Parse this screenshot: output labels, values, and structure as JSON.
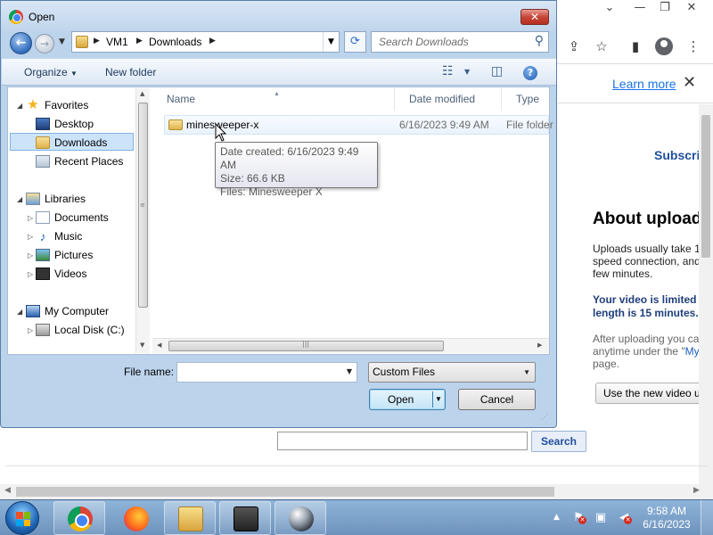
{
  "dialog": {
    "title": "Open",
    "close_label": "✕",
    "breadcrumb": [
      "VM1",
      "Downloads"
    ],
    "search_placeholder": "Search Downloads",
    "toolbar": {
      "organize": "Organize",
      "new_folder": "New folder"
    },
    "nav": {
      "favorites": "Favorites",
      "desktop": "Desktop",
      "downloads": "Downloads",
      "recent_places": "Recent Places",
      "libraries": "Libraries",
      "documents": "Documents",
      "music": "Music",
      "pictures": "Pictures",
      "videos": "Videos",
      "my_computer": "My Computer",
      "local_disk": "Local Disk (C:)"
    },
    "columns": {
      "name": "Name",
      "date_modified": "Date modified",
      "type": "Type"
    },
    "files": [
      {
        "name": "minesweeper-x",
        "date_modified": "6/16/2023 9:49 AM",
        "type": "File folder"
      }
    ],
    "tooltip": {
      "line1": "Date created: 6/16/2023 9:49 AM",
      "line2": "Size: 66.6 KB",
      "line3": "Files: Minesweeper X"
    },
    "file_name_label": "File name:",
    "file_name_value": "",
    "file_type": "Custom Files",
    "open_button": "Open",
    "cancel_button": "Cancel"
  },
  "browser": {
    "learn_more": "Learn more",
    "subscribe": "Subscri",
    "about_title": "About upload",
    "about_text": [
      "Uploads usually take 1",
      "speed connection, and",
      "few minutes."
    ],
    "about_bold": [
      "Your video is limited",
      "length is 15 minutes."
    ],
    "about_gray_1": "After uploading you ca",
    "about_gray_2a": "anytime under the \"",
    "about_gray_2b": "My",
    "about_gray_3": "page.",
    "new_video_button": "Use the new video u",
    "search_button": "Search"
  },
  "taskbar": {
    "time": "9:58 AM",
    "date": "6/16/2023",
    "apps": [
      "chrome-icon",
      "firefox-icon",
      "explorer-icon",
      "tool-icon",
      "ball-icon"
    ]
  }
}
